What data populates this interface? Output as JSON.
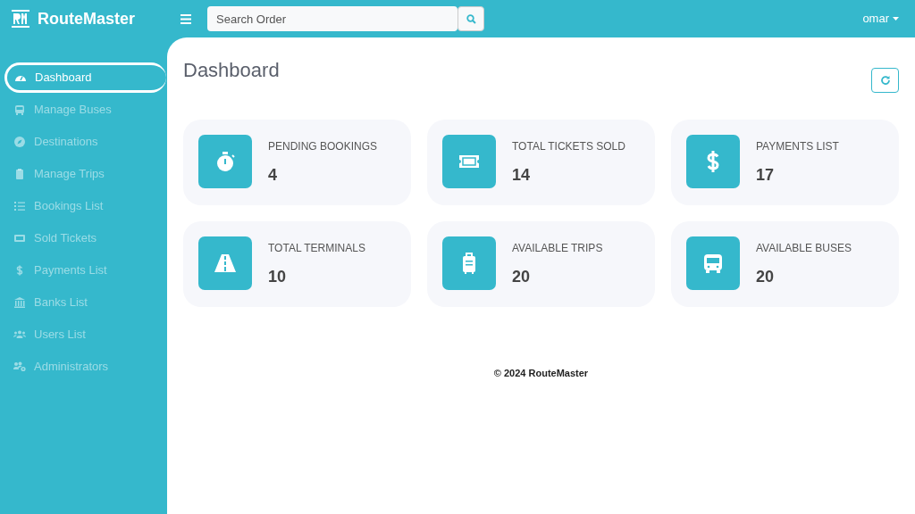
{
  "brand": "RouteMaster",
  "search": {
    "placeholder": "Search Order"
  },
  "user": "omar",
  "sidebar": {
    "items": [
      {
        "label": "Dashboard",
        "selected": true
      },
      {
        "label": "Manage Buses",
        "selected": false
      },
      {
        "label": "Destinations",
        "selected": false
      },
      {
        "label": "Manage Trips",
        "selected": false
      },
      {
        "label": "Bookings List",
        "selected": false
      },
      {
        "label": "Sold Tickets",
        "selected": false
      },
      {
        "label": "Payments List",
        "selected": false
      },
      {
        "label": "Banks List",
        "selected": false
      },
      {
        "label": "Users List",
        "selected": false
      },
      {
        "label": "Administrators",
        "selected": false
      }
    ]
  },
  "page_title": "Dashboard",
  "stats": [
    {
      "label": "PENDING BOOKINGS",
      "value": "4"
    },
    {
      "label": "TOTAL TICKETS SOLD",
      "value": "14"
    },
    {
      "label": "PAYMENTS LIST",
      "value": "17"
    },
    {
      "label": "TOTAL TERMINALS",
      "value": "10"
    },
    {
      "label": "AVAILABLE TRIPS",
      "value": "20"
    },
    {
      "label": "AVAILABLE BUSES",
      "value": "20"
    }
  ],
  "footer": "© 2024 RouteMaster"
}
